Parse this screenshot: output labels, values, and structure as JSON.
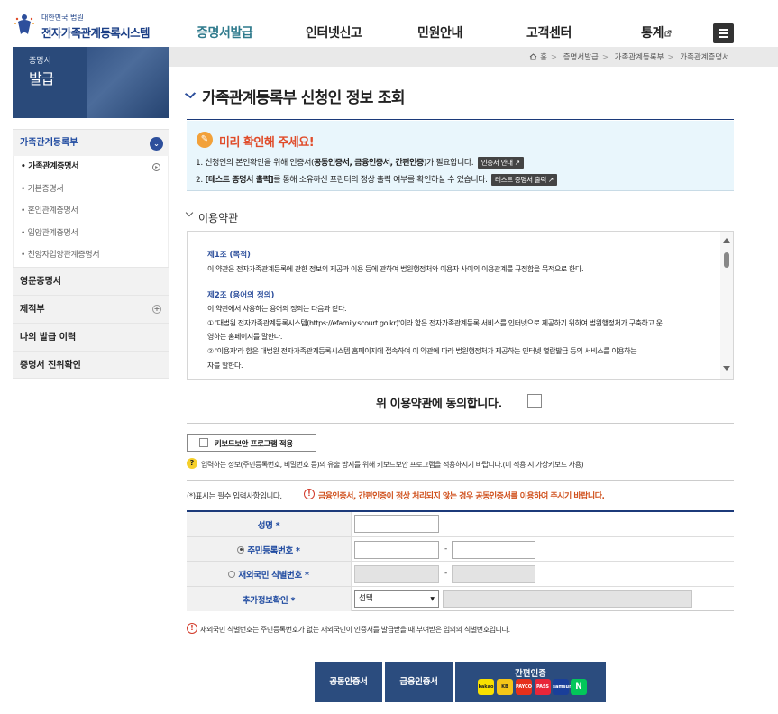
{
  "header": {
    "logo_small": "대한민국 법원",
    "logo_title": "전자가족관계등록시스템",
    "nav": [
      "증명서발급",
      "인터넷신고",
      "민원안내",
      "고객센터",
      "통계"
    ],
    "external_icon": "external-link-icon",
    "menu_icon": "hamburger-icon"
  },
  "sidebar": {
    "banner_line1": "증명서",
    "banner_line2": "발급",
    "group_title": "가족관계등록부",
    "group_items": [
      "가족관계증명서",
      "기본증명서",
      "혼인관계증명서",
      "입양관계증명서",
      "친양자입양관계증명서"
    ],
    "active_index": 0,
    "menus": [
      "영문증명서",
      "제적부",
      "나의 발급 이력",
      "증명서 진위확인"
    ]
  },
  "breadcrumb": [
    "홈",
    "증명서발급",
    "가족관계등록부",
    "가족관계증명서"
  ],
  "page_title": "가족관계등록부 신청인 정보 조회",
  "notice": {
    "heading": "미리 확인해 주세요!",
    "line1_prefix": "1. 신청인의 본인확인을 위해 인증서(",
    "line1_bold": "공동인증서, 금융인증서, 간편인증",
    "line1_suffix": ")가 필요합니다.",
    "line1_button": "인증서 안내",
    "line2_bold": "[테스트 증명서 출력]",
    "line2_suffix": "를 통해 소유하신 프린터의 정상 출력 여부를 확인하실 수 있습니다.",
    "line2_button": "테스트 증명서 출력"
  },
  "terms": {
    "title": "이용약관",
    "article1_title": "제1조 (목적)",
    "article1_text": "이 약관은 전자가족관계등록에 관한 정보의 제공과 이용 등에 관하여 법원행정처와 이용자 사이의 이용관계를 규정함을 목적으로 한다.",
    "article2_title": "제2조 (용어의 정의)",
    "article2_lines": [
      "이 약관에서 사용하는 용어의 정의는 다음과 같다.",
      "① '대법원 전자가족관계등록시스템(https://efamily.scourt.go.kr)'이라 함은 전자가족관계등록 서비스를 인터넷으로 제공하기 위하여 법원행정처가 구축하고 운",
      "영하는 홈페이지를 말한다.",
      "② '이용자'라 함은 대법원 전자가족관계등록시스템 홈페이지에 접속하여 이 약관에 따라 법원행정처가 제공하는 인터넷 열람발급 등의 서비스를 이용하는",
      "자를 말한다."
    ]
  },
  "agree_label": "위 이용약관에 동의합니다.",
  "keyboard": {
    "button": "키보드보안 프로그램 적용",
    "note": "입력하는 정보(주민등록번호, 비밀번호 등)의 유출 방지를 위해 키보드보안 프로그램을 적용하시기 바랍니다.(미 적용 시 가상키보드 사용)"
  },
  "required_note": "(*)표시는 필수 입력사항입니다.",
  "warning": "금융인증서, 간편인증이 정상 처리되지 않는 경우 공동인증서를 이용하여 주시기 바랍니다.",
  "form": {
    "name_label": "성명",
    "rrn_label": "주민등록번호",
    "foreign_label": "재외국민 식별번호",
    "extra_label": "추가정보확인",
    "star": "*",
    "dash": "-",
    "select_value": "선택"
  },
  "foreign_note": "재외국민 식별번호는 주민등록번호가 없는 재외국민이 인증서를 발급받을 때 부여받은 임의의 식별번호입니다.",
  "buttons": {
    "joint": "공동인증서",
    "financial": "금융인증서",
    "simple": "간편인증",
    "providers": [
      "kakao",
      "KB",
      "PAYCO",
      "PASS",
      "samsung",
      "N"
    ]
  },
  "colors": {
    "accent": "#2b4c7e",
    "title_line": "#1c3a7a",
    "notice_bg": "#e9f6fc",
    "warning": "#d0511d"
  }
}
